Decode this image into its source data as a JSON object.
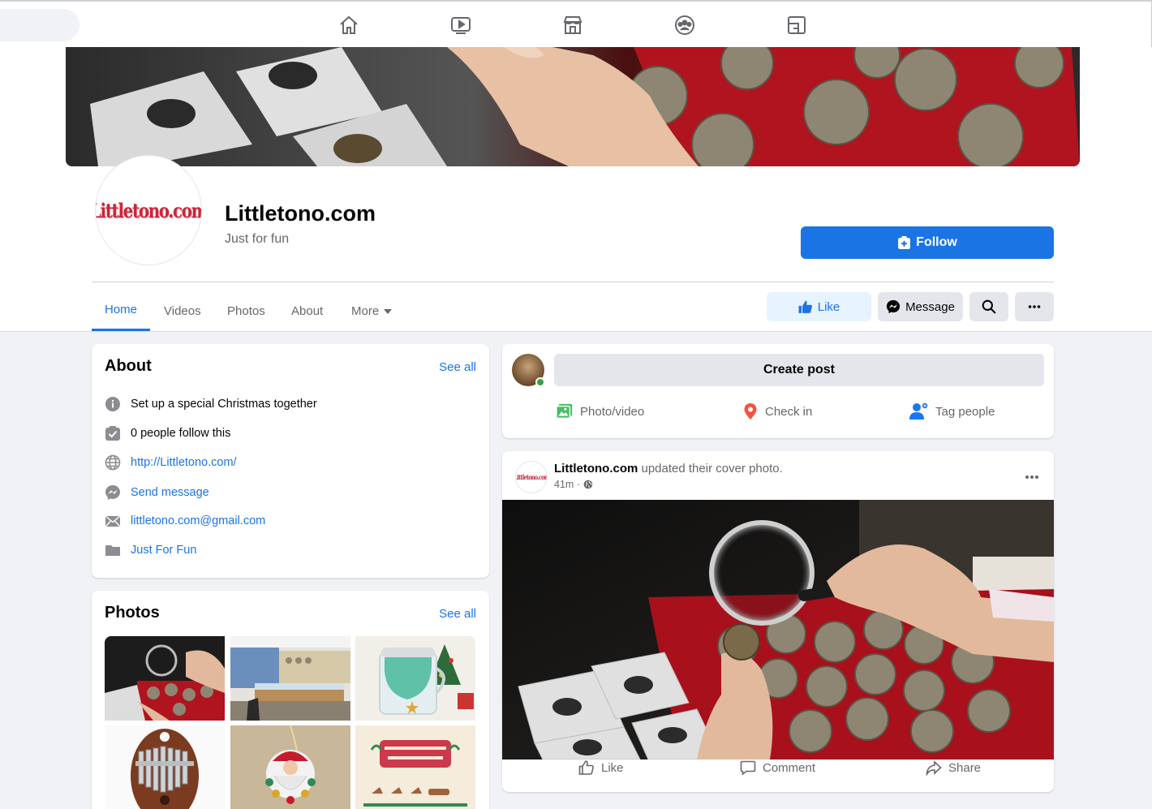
{
  "nav": {
    "icons": [
      "home-icon",
      "watch-icon",
      "marketplace-icon",
      "groups-icon",
      "gaming-icon"
    ]
  },
  "page": {
    "name": "Littletono.com",
    "category": "Just for fun",
    "logo_text": "Littletono.com",
    "follow_label": "Follow"
  },
  "tabs": [
    {
      "label": "Home",
      "active": true
    },
    {
      "label": "Videos"
    },
    {
      "label": "Photos"
    },
    {
      "label": "About"
    },
    {
      "label": "More"
    }
  ],
  "actions": {
    "like": "Like",
    "message": "Message"
  },
  "about": {
    "title": "About",
    "see_all": "See all",
    "items": [
      {
        "icon": "info-icon",
        "text": "Set up a special Christmas together",
        "link": false
      },
      {
        "icon": "follow-check-icon",
        "text": "0 people follow this",
        "link": false
      },
      {
        "icon": "globe-icon",
        "text": "http://Littletono.com/",
        "link": true
      },
      {
        "icon": "messenger-icon",
        "text": "Send message",
        "link": true
      },
      {
        "icon": "mail-icon",
        "text": "littletono.com@gmail.com",
        "link": true
      },
      {
        "icon": "category-icon",
        "text": "Just For Fun",
        "link": true
      }
    ]
  },
  "photos": {
    "title": "Photos",
    "see_all": "See all"
  },
  "composer": {
    "create_post": "Create post",
    "photo_video": "Photo/video",
    "check_in": "Check in",
    "tag_people": "Tag people"
  },
  "post": {
    "author": "Littletono.com",
    "action": " updated their cover photo.",
    "time": "41m ·",
    "like": "Like",
    "comment": "Comment",
    "share": "Share"
  },
  "colors": {
    "brand": "#1b74e4",
    "bg": "#f0f2f5",
    "secondary_text": "#65676b",
    "logo_red": "#c8263a"
  }
}
